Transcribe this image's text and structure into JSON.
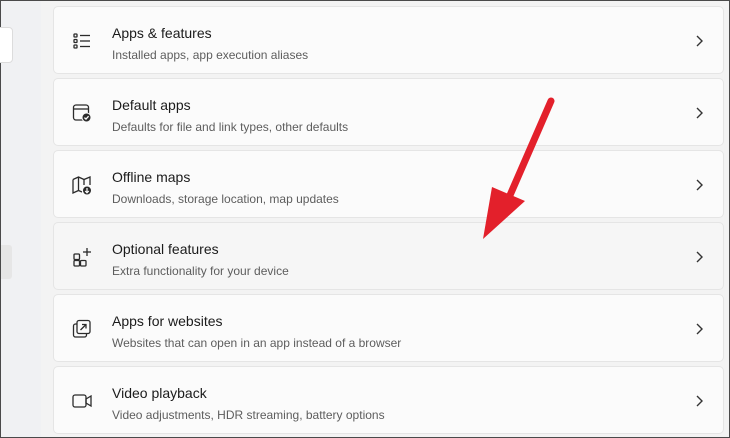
{
  "settings_list": {
    "items": [
      {
        "title": "Apps & features",
        "subtitle": "Installed apps, app execution aliases"
      },
      {
        "title": "Default apps",
        "subtitle": "Defaults for file and link types, other defaults"
      },
      {
        "title": "Offline maps",
        "subtitle": "Downloads, storage location, map updates"
      },
      {
        "title": "Optional features",
        "subtitle": "Extra functionality for your device"
      },
      {
        "title": "Apps for websites",
        "subtitle": "Websites that can open in an app instead of a browser"
      },
      {
        "title": "Video playback",
        "subtitle": "Video adjustments, HDR streaming, battery options"
      }
    ]
  },
  "icons": [
    "list-icon",
    "default-apps-icon",
    "map-download-icon",
    "grid-plus-icon",
    "external-open-icon",
    "video-camera-icon"
  ],
  "colors": {
    "annotation_arrow": "#e3202b",
    "text_primary": "#1b1b1b",
    "text_secondary": "#5d5d5d"
  }
}
